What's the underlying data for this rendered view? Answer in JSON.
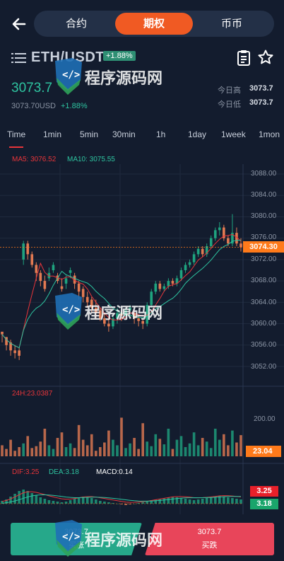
{
  "nav": {
    "tabs": [
      {
        "label": "合约",
        "active": false
      },
      {
        "label": "期权",
        "active": true
      },
      {
        "label": "币币",
        "active": false
      }
    ]
  },
  "pair": {
    "name": "ETH/USDT",
    "change_badge": "+1.88%"
  },
  "price": {
    "last": "3073.7",
    "usd": "3073.70USD",
    "change": "+1.88%",
    "high_label": "今日高",
    "high": "3073.7",
    "low_label": "今日低",
    "low": "3073.7"
  },
  "timeframes": [
    "Time",
    "1min",
    "5min",
    "30min",
    "1h",
    "1day",
    "1week",
    "1mon"
  ],
  "ma": {
    "ma5": "MA5: 3076.52",
    "ma10": "MA10: 3075.55"
  },
  "price_axis": [
    "3088.00",
    "3084.00",
    "3080.00",
    "3076.00",
    "3072.00",
    "3068.00",
    "3064.00",
    "3060.00",
    "3056.00",
    "3052.00"
  ],
  "current_price_tag": "3074.30",
  "volume": {
    "label": "24H:23.0387",
    "axis_label": "200.00",
    "current_tag": "23.04"
  },
  "macd": {
    "dif": "DIF:3.25",
    "dea": "DEA:3.18",
    "macd": "MACD:0.14",
    "tags": [
      "3.25",
      "3.18"
    ]
  },
  "actions": {
    "buy_price": "3073.7",
    "buy_label": "买涨",
    "sell_price": "3073.7",
    "sell_label": "买跌"
  },
  "watermark": {
    "text": "程序源码网"
  },
  "colors": {
    "background": "#131c2e",
    "up": "#26a88a",
    "down": "#e8455a",
    "accent": "#f05a23",
    "candle_up": "#1fa37f",
    "candle_down": "#e27a52"
  },
  "chart_data": {
    "type": "candlestick",
    "price_range": [
      3050,
      3090
    ],
    "candles": [
      [
        3058.5,
        3058.0,
        3056.5,
        3058.0
      ],
      [
        3057.5,
        3056.0,
        3055.0,
        3057.5
      ],
      [
        3056.5,
        3055.0,
        3054.0,
        3057.0
      ],
      [
        3055.0,
        3054.5,
        3053.5,
        3056.0
      ],
      [
        3055.0,
        3054.0,
        3053.2,
        3055.5
      ],
      [
        3072.0,
        3075.0,
        3071.0,
        3075.5
      ],
      [
        3075.0,
        3073.0,
        3072.0,
        3075.5
      ],
      [
        3073.0,
        3071.0,
        3070.5,
        3073.5
      ],
      [
        3071.0,
        3069.5,
        3068.0,
        3071.5
      ],
      [
        3069.5,
        3068.0,
        3067.0,
        3070.0
      ],
      [
        3068.0,
        3066.5,
        3066.0,
        3069.0
      ],
      [
        3068.5,
        3069.5,
        3068.0,
        3070.5
      ],
      [
        3070.0,
        3071.0,
        3069.5,
        3071.5
      ],
      [
        3069.0,
        3068.0,
        3067.5,
        3069.5
      ],
      [
        3067.0,
        3066.5,
        3066.0,
        3068.5
      ],
      [
        3067.5,
        3068.5,
        3066.5,
        3069.0
      ],
      [
        3069.5,
        3070.0,
        3068.5,
        3070.5
      ],
      [
        3069.0,
        3067.5,
        3066.5,
        3069.5
      ],
      [
        3067.5,
        3066.0,
        3064.5,
        3068.0
      ],
      [
        3066.5,
        3065.0,
        3064.0,
        3067.0
      ],
      [
        3065.0,
        3064.0,
        3063.0,
        3066.0
      ],
      [
        3064.5,
        3063.0,
        3062.0,
        3065.0
      ],
      [
        3063.0,
        3062.0,
        3061.0,
        3064.5
      ],
      [
        3062.5,
        3061.0,
        3060.5,
        3063.0
      ],
      [
        3061.0,
        3060.0,
        3059.5,
        3062.0
      ],
      [
        3060.0,
        3059.5,
        3058.5,
        3061.0
      ],
      [
        3059.5,
        3061.0,
        3059.0,
        3061.5
      ],
      [
        3061.0,
        3062.0,
        3060.0,
        3063.0
      ],
      [
        3062.0,
        3061.5,
        3060.5,
        3062.5
      ],
      [
        3061.5,
        3062.5,
        3061.0,
        3063.0
      ],
      [
        3062.5,
        3063.0,
        3061.5,
        3063.5
      ],
      [
        3062.0,
        3061.0,
        3060.0,
        3062.5
      ],
      [
        3061.0,
        3060.5,
        3059.5,
        3061.5
      ],
      [
        3060.5,
        3060.0,
        3059.0,
        3061.0
      ],
      [
        3060.0,
        3063.5,
        3059.5,
        3064.0
      ],
      [
        3063.5,
        3066.0,
        3063.0,
        3066.5
      ],
      [
        3066.0,
        3067.5,
        3065.5,
        3068.0
      ],
      [
        3067.5,
        3066.5,
        3066.0,
        3068.0
      ],
      [
        3066.5,
        3067.0,
        3066.0,
        3067.5
      ],
      [
        3067.0,
        3068.0,
        3066.5,
        3068.5
      ],
      [
        3068.0,
        3067.5,
        3067.0,
        3068.5
      ],
      [
        3067.5,
        3068.5,
        3067.0,
        3069.0
      ],
      [
        3068.5,
        3070.0,
        3068.0,
        3070.5
      ],
      [
        3070.0,
        3071.0,
        3069.5,
        3071.5
      ],
      [
        3071.0,
        3071.5,
        3070.5,
        3072.0
      ],
      [
        3071.5,
        3073.0,
        3071.0,
        3073.5
      ],
      [
        3073.0,
        3074.0,
        3072.5,
        3074.5
      ],
      [
        3074.0,
        3073.0,
        3072.5,
        3074.5
      ],
      [
        3073.0,
        3074.5,
        3072.5,
        3075.0
      ],
      [
        3074.5,
        3076.0,
        3074.0,
        3076.5
      ],
      [
        3076.0,
        3077.5,
        3075.5,
        3078.0
      ],
      [
        3077.5,
        3078.0,
        3076.5,
        3079.0
      ],
      [
        3078.0,
        3076.0,
        3075.5,
        3078.5
      ],
      [
        3076.0,
        3075.0,
        3074.5,
        3076.5
      ],
      [
        3075.0,
        3077.0,
        3074.5,
        3080.5
      ],
      [
        3077.0,
        3075.0,
        3074.5,
        3078.0
      ],
      [
        3075.0,
        3074.3,
        3073.5,
        3076.0
      ]
    ],
    "volumes": [
      12,
      8,
      18,
      6,
      10,
      14,
      22,
      9,
      11,
      16,
      30,
      12,
      8,
      20,
      26,
      10,
      14,
      9,
      34,
      18,
      12,
      24,
      6,
      10,
      15,
      28,
      18,
      12,
      42,
      9,
      14,
      20,
      8,
      36,
      16,
      11,
      24,
      19,
      13,
      30,
      8,
      18,
      22,
      10,
      14,
      26,
      12,
      20,
      16,
      9,
      30,
      18,
      24,
      12,
      28,
      15,
      23
    ],
    "macd_hist": [
      4,
      6,
      10,
      14,
      18,
      20,
      18,
      15,
      12,
      9,
      7,
      5,
      4,
      3,
      2,
      3,
      5,
      7,
      9,
      10,
      9,
      8,
      6,
      4,
      3,
      2,
      1,
      0,
      -1,
      -2,
      -1,
      0,
      1,
      2,
      3,
      5,
      6,
      7,
      8,
      9,
      10,
      9,
      8,
      7,
      6,
      5,
      6,
      7,
      8,
      9,
      10,
      11,
      10,
      9,
      8,
      7,
      6
    ]
  }
}
